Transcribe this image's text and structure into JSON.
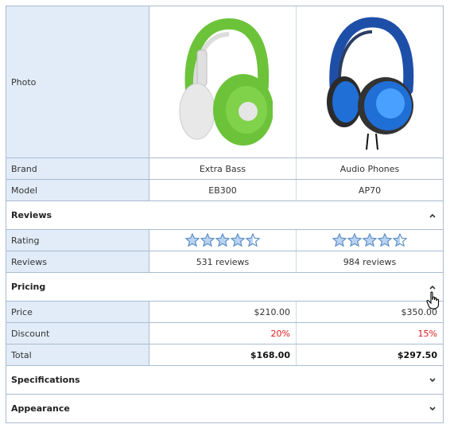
{
  "labels": {
    "photo": "Photo",
    "brand": "Brand",
    "model": "Model",
    "rating": "Rating",
    "reviews": "Reviews",
    "price": "Price",
    "discount": "Discount",
    "total": "Total"
  },
  "groups": {
    "reviews": "Reviews",
    "pricing": "Pricing",
    "specifications": "Specifications",
    "appearance": "Appearance"
  },
  "products": [
    {
      "brand": "Extra Bass",
      "model": "EB300",
      "rating": 4.5,
      "reviews": "531 reviews",
      "price": "$210.00",
      "discount": "20%",
      "total": "$168.00",
      "image_color": "#6cc33a"
    },
    {
      "brand": "Audio Phones",
      "model": "AP70",
      "rating": 4.5,
      "reviews": "984 reviews",
      "price": "$350.00",
      "discount": "15%",
      "total": "$297.50",
      "image_color": "#1f6fd6"
    }
  ],
  "colors": {
    "label_bg": "#e1ecf8",
    "border": "#a9bcd0",
    "discount_red": "#e0191b",
    "star_fill": "#b9d3f1",
    "star_stroke": "#5f8fc7"
  }
}
